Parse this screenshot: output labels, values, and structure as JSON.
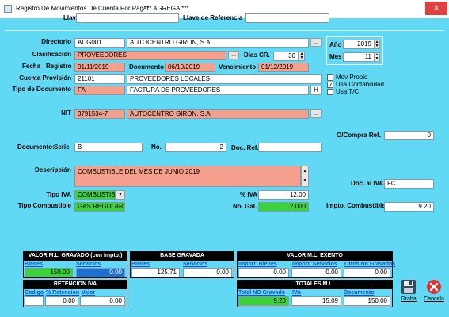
{
  "window": {
    "title": "Registro De Movimientos De Cuenta Por Pagar",
    "mode": "*** AGREGA ***",
    "close_label": "✕"
  },
  "top": {
    "llave_label": "Llave",
    "llave_ref_label": "Llave de Referencia",
    "llave_value": "",
    "llave_ref_value": ""
  },
  "form": {
    "directorio_label": "Directorio",
    "directorio_code": "ACG001",
    "directorio_name": "AUTOCENTRO GIRON, S.A.",
    "clasificacion_label": "Clasificación",
    "clasificacion_value": "PROVEEDORES",
    "dias_cr_label": "Dias CR.",
    "dias_cr_value": "30",
    "fecha_label": "Fecha",
    "registro_label": "Registro",
    "registro_value": "01/11/2019",
    "documento_label": "Documento",
    "documento_value": "06/10/2019",
    "vencimiento_label": "Vencimiento",
    "vencimiento_value": "01/12/2019",
    "cuenta_label": "Cuenta Provisión",
    "cuenta_code": "21101",
    "cuenta_name": "PROVEEDORES LOCALES",
    "tipo_doc_label": "Tipo de Documento",
    "tipo_doc_code": "FA",
    "tipo_doc_name": "FACTURA DE PROVEEDORES",
    "tipo_doc_flag": "H",
    "nit_label": "NIT",
    "nit_value": "3791534-7",
    "nit_name": "AUTOCENTRO GIRON, S.A.",
    "ellipsis": "...",
    "anio_label": "Año",
    "anio_value": "2019",
    "mes_label": "Mes",
    "mes_value": "11",
    "mov_propio_label": "Mov Propio",
    "usa_contabilidad_label": "Usa Contabilidad",
    "usa_tc_label": "Usa T/C",
    "ocompra_label": "O/Compra Ref.",
    "ocompra_value": "0",
    "doc_label": "Documento:",
    "serie_label": "Serie",
    "serie_value": "B",
    "no_label": "No.",
    "no_value": "2",
    "doc_ref_label": "Doc. Ref.",
    "doc_ref_value": "",
    "descripcion_label": "Descripción",
    "descripcion_value": "COMBUSTIBLE DEL MES DE JUNIO 2019",
    "doc_iva_label": "Doc. al IVA",
    "doc_iva_value": "FC",
    "tipo_iva_label": "Tipo IVA",
    "tipo_iva_value": "COMBUSTIBL",
    "pct_iva_label": "% IVA",
    "pct_iva_value": "12.00",
    "tipo_comb_label": "Tipo Combustible",
    "tipo_comb_value": "GAS REGULAR",
    "no_gal_label": "No. Gal.",
    "no_gal_value": "2.000",
    "impto_comb_label": "Impto. Combustible",
    "impto_comb_value": "9.20"
  },
  "totals": {
    "vm_gravado_header": "VALOR M.L. GRAVADO (con Impto.)",
    "bienes_label": "Bienes",
    "bienes_value": "150.00",
    "servicios_label": "Servicios",
    "servicios_value": "0.00",
    "base_header": "BASE GRAVADA",
    "base_bienes_label": "Bienes",
    "base_bienes_value": "125.71",
    "base_servicios_label": "Servicios",
    "base_servicios_value": "0.00",
    "exento_header": "VALOR M.L. EXENTO",
    "import_bienes_label": "Import. Bienes",
    "import_bienes_value": "0.00",
    "import_servicios_label": "Import. Servicios",
    "import_servicios_value": "0.00",
    "otros_label": "Otros No Gravados",
    "otros_value": "0.00",
    "retencion_header": "RETENCION IVA",
    "codigo_label": "Codigo",
    "pct_ret_label": "% Retencion",
    "pct_ret_value": "0.00",
    "valor_label": "Valor",
    "valor_value": "0.00",
    "totales_header": "TOTALES M.L.",
    "total_no_grav_label": "Total NO Gravado",
    "total_no_grav_value": "9.20",
    "iva_label": "IVA",
    "iva_value": "15.09",
    "documento_label": "Documento",
    "documento_value": "150.00"
  },
  "actions": {
    "grabar_label": "Graba",
    "cancelar_label": "Cancela"
  },
  "colors": {
    "panel_bg": "#62d9f4",
    "salmon": "#f4a08c",
    "green": "#3cd23c",
    "blue": "#1e6fd2",
    "close_red": "#e04040"
  }
}
